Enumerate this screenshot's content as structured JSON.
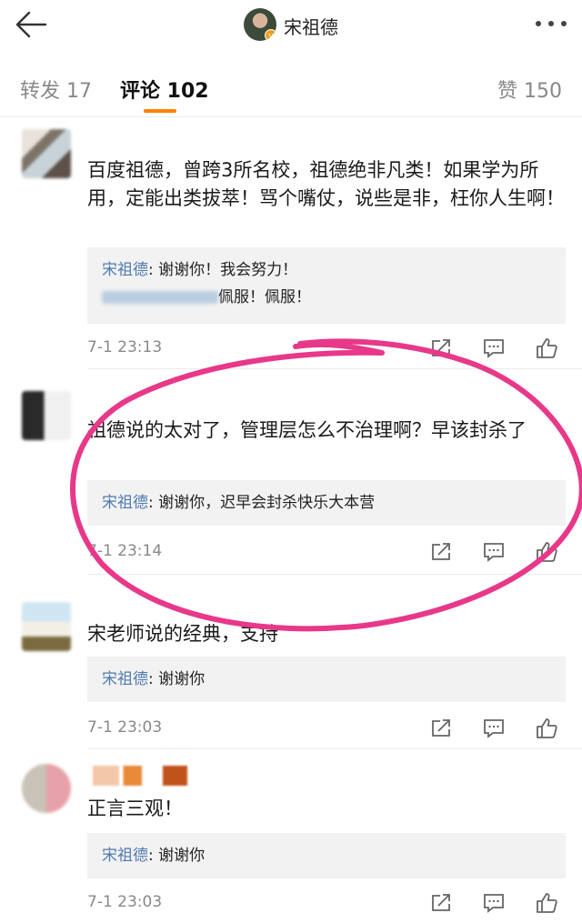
{
  "header": {
    "back_icon": "back-arrow-icon",
    "user_name": "宋祖德",
    "verified_badge": "v",
    "more_icon": "more-dots-icon"
  },
  "tabs": {
    "repost": "转发 17",
    "comments": "评论 102",
    "likes": "赞 150",
    "active": "comments",
    "accent_color": "#ff8200"
  },
  "comments": [
    {
      "text": "百度祖德，曾跨3所名校，祖德绝非凡类！如果学为所用，定能出类拔萃！骂个嘴仗，说些是非，枉你人生啊！",
      "replies": [
        {
          "author": "宋祖德",
          "text": ": 谢谢你！我会努力！"
        },
        {
          "author": "",
          "text": "佩服！佩服！"
        }
      ],
      "time": "7-1 23:13"
    },
    {
      "text": "祖德说的太对了，管理层怎么不治理啊？早该封杀了",
      "replies": [
        {
          "author": "宋祖德",
          "text": ": 谢谢你，迟早会封杀快乐大本营"
        }
      ],
      "time": "7-1 23:14"
    },
    {
      "text": "宋老师说的经典，支持",
      "replies": [
        {
          "author": "宋祖德",
          "text": ": 谢谢你"
        }
      ],
      "time": "7-1 23:03"
    },
    {
      "text": "正言三观！",
      "replies": [
        {
          "author": "宋祖德",
          "text": ": 谢谢你"
        }
      ],
      "time": "7-1 23:03"
    }
  ],
  "action_icons": [
    "share-icon",
    "comment-icon",
    "like-icon"
  ],
  "colors": {
    "reply_author": "#4f7ab0",
    "annotation": "#e8388a"
  }
}
